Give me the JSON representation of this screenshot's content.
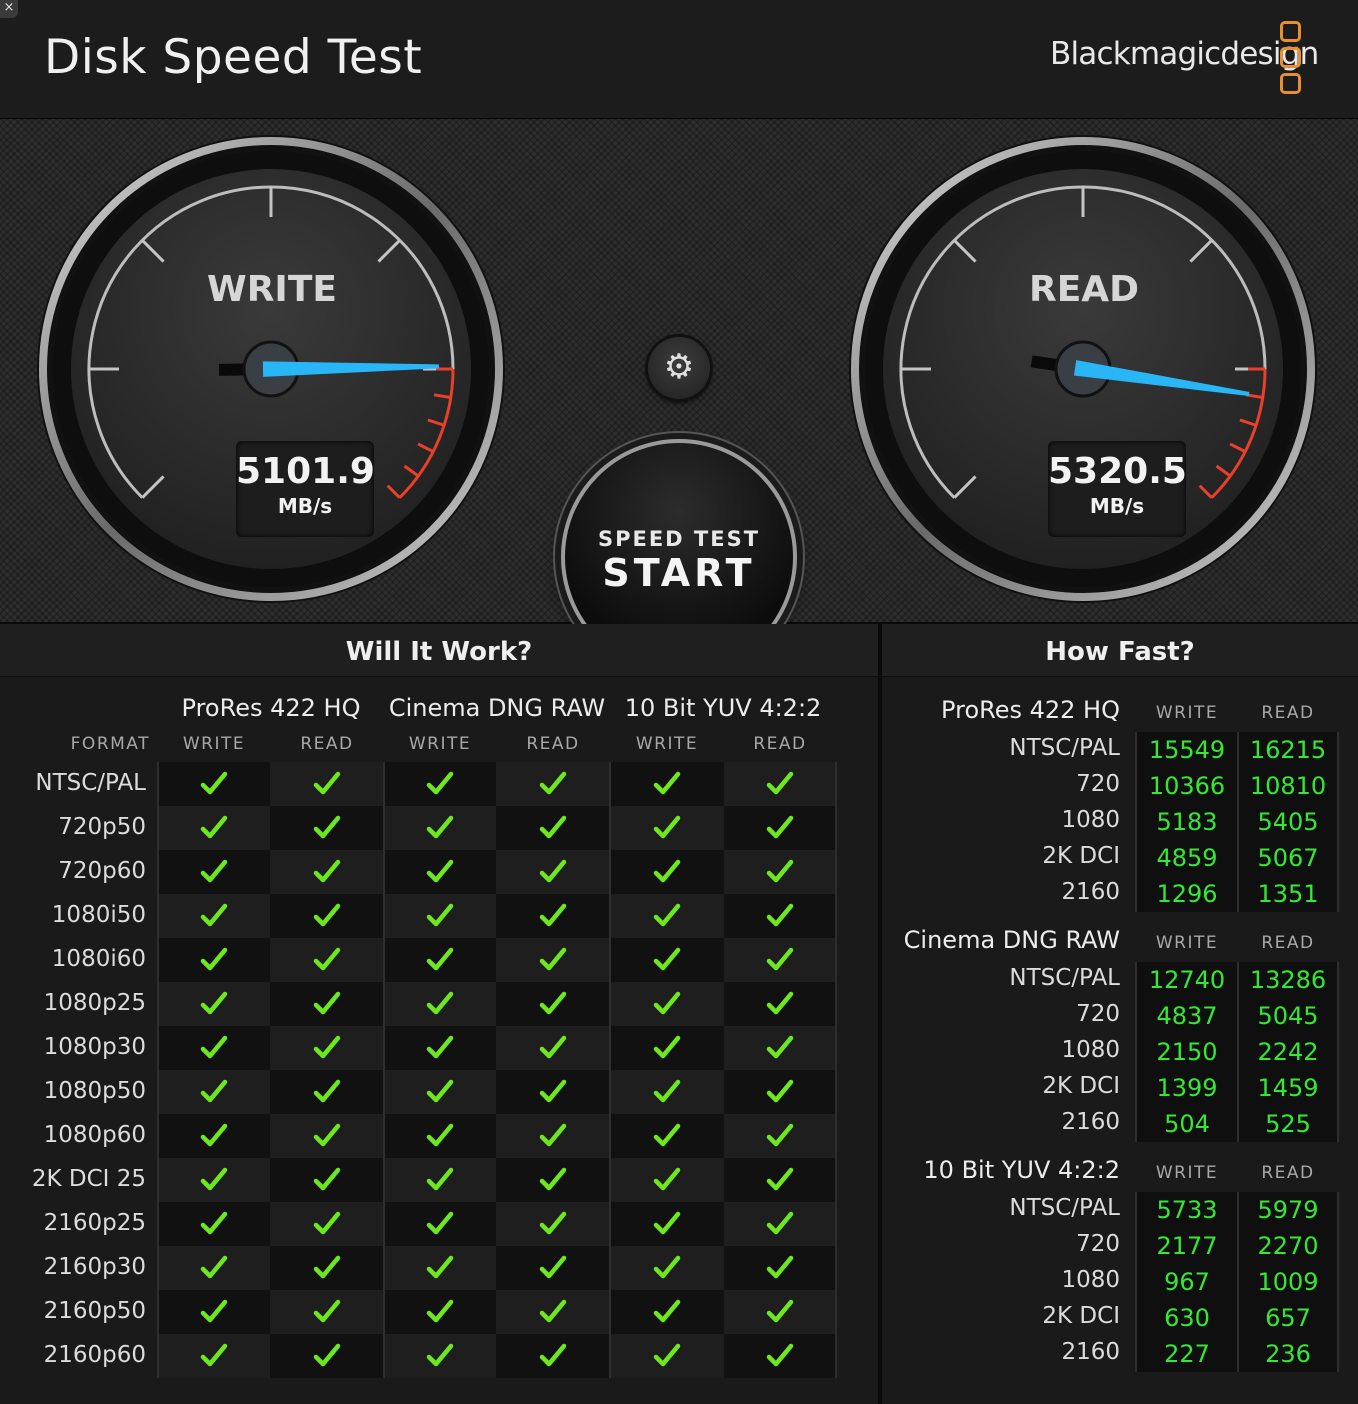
{
  "window": {
    "close_glyph": "×"
  },
  "header": {
    "title": "Disk Speed Test",
    "brand": "Blackmagicdesign",
    "brand_color": "#e8902f"
  },
  "gauges": {
    "write": {
      "label": "WRITE",
      "value": "5101.9",
      "unit": "MB/s",
      "needle_fraction": 0.83
    },
    "read": {
      "label": "READ",
      "value": "5320.5",
      "unit": "MB/s",
      "needle_fraction": 0.865
    }
  },
  "controls": {
    "settings_icon": "gear-icon",
    "start_top": "SPEED TEST",
    "start_main": "START"
  },
  "colors": {
    "needle": "#29b6f6",
    "redline": "#e8402a",
    "check": "#6ee81e",
    "fast_value": "#34e834"
  },
  "will_it_work": {
    "title": "Will It Work?",
    "format_header": "FORMAT",
    "write_header": "WRITE",
    "read_header": "READ",
    "groups": [
      "ProRes 422 HQ",
      "Cinema DNG RAW",
      "10 Bit YUV 4:2:2"
    ],
    "formats": [
      "NTSC/PAL",
      "720p50",
      "720p60",
      "1080i50",
      "1080i60",
      "1080p25",
      "1080p30",
      "1080p50",
      "1080p60",
      "2K DCI 25",
      "2160p25",
      "2160p30",
      "2160p50",
      "2160p60"
    ],
    "supported": [
      [
        true,
        true,
        true,
        true,
        true,
        true
      ],
      [
        true,
        true,
        true,
        true,
        true,
        true
      ],
      [
        true,
        true,
        true,
        true,
        true,
        true
      ],
      [
        true,
        true,
        true,
        true,
        true,
        true
      ],
      [
        true,
        true,
        true,
        true,
        true,
        true
      ],
      [
        true,
        true,
        true,
        true,
        true,
        true
      ],
      [
        true,
        true,
        true,
        true,
        true,
        true
      ],
      [
        true,
        true,
        true,
        true,
        true,
        true
      ],
      [
        true,
        true,
        true,
        true,
        true,
        true
      ],
      [
        true,
        true,
        true,
        true,
        true,
        true
      ],
      [
        true,
        true,
        true,
        true,
        true,
        true
      ],
      [
        true,
        true,
        true,
        true,
        true,
        true
      ],
      [
        true,
        true,
        true,
        true,
        true,
        true
      ],
      [
        true,
        true,
        true,
        true,
        true,
        true
      ]
    ]
  },
  "how_fast": {
    "title": "How Fast?",
    "write_header": "WRITE",
    "read_header": "READ",
    "groups": [
      {
        "name": "ProRes 422 HQ",
        "rows": [
          {
            "label": "NTSC/PAL",
            "write": "15549",
            "read": "16215"
          },
          {
            "label": "720",
            "write": "10366",
            "read": "10810"
          },
          {
            "label": "1080",
            "write": "5183",
            "read": "5405"
          },
          {
            "label": "2K DCI",
            "write": "4859",
            "read": "5067"
          },
          {
            "label": "2160",
            "write": "1296",
            "read": "1351"
          }
        ]
      },
      {
        "name": "Cinema DNG RAW",
        "rows": [
          {
            "label": "NTSC/PAL",
            "write": "12740",
            "read": "13286"
          },
          {
            "label": "720",
            "write": "4837",
            "read": "5045"
          },
          {
            "label": "1080",
            "write": "2150",
            "read": "2242"
          },
          {
            "label": "2K DCI",
            "write": "1399",
            "read": "1459"
          },
          {
            "label": "2160",
            "write": "504",
            "read": "525"
          }
        ]
      },
      {
        "name": "10 Bit YUV 4:2:2",
        "rows": [
          {
            "label": "NTSC/PAL",
            "write": "5733",
            "read": "5979"
          },
          {
            "label": "720",
            "write": "2177",
            "read": "2270"
          },
          {
            "label": "1080",
            "write": "967",
            "read": "1009"
          },
          {
            "label": "2K DCI",
            "write": "630",
            "read": "657"
          },
          {
            "label": "2160",
            "write": "227",
            "read": "236"
          }
        ]
      }
    ]
  }
}
